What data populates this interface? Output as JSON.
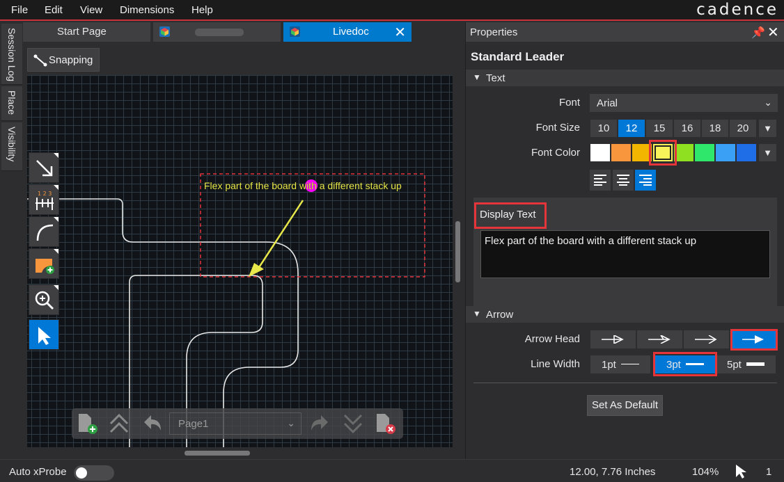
{
  "menu": [
    "File",
    "Edit",
    "View",
    "Dimensions",
    "Help"
  ],
  "brand": "cadence",
  "side_tabs": [
    "Session Log",
    "Place",
    "Visibility"
  ],
  "doc_tabs": {
    "start": "Start Page",
    "active": "Livedoc"
  },
  "toolbar": {
    "snapping": "Snapping"
  },
  "canvas": {
    "annotation_text": "Flex part of the board with a different stack up",
    "colors": {
      "annotation": "#e8e84a",
      "marker": "#ff00ff",
      "selection": "#e5353b",
      "trace": "#e8e8e8"
    }
  },
  "tools": [
    "arrow-line-icon",
    "dimension-icon",
    "arc-icon",
    "add-shape-icon",
    "zoom-icon",
    "select-pointer-icon"
  ],
  "pagebar": {
    "page": "Page1"
  },
  "properties": {
    "header": "Properties",
    "title": "Standard Leader",
    "text_section": "Text",
    "font_label": "Font",
    "font_value": "Arial",
    "font_size_label": "Font Size",
    "font_sizes": [
      "10",
      "12",
      "15",
      "16",
      "18",
      "20"
    ],
    "font_size_selected": "12",
    "font_color_label": "Font Color",
    "font_colors": [
      "#ffffff",
      "#f7963c",
      "#f3b600",
      "#f7f25a",
      "#8fe021",
      "#2fe76a",
      "#3aa0f5",
      "#1f6ee8"
    ],
    "font_color_selected": "#f7f25a",
    "display_text_label": "Display Text",
    "display_text_value": "Flex part of the board with a different stack up",
    "arrow_section": "Arrow",
    "arrow_head_label": "Arrow Head",
    "line_width_label": "Line Width",
    "line_widths": [
      "1pt",
      "3pt",
      "5pt"
    ],
    "line_width_selected": "3pt",
    "set_default": "Set As Default"
  },
  "status": {
    "auto_xprobe": "Auto xProbe",
    "auto_xprobe_on": false,
    "coords": "12.00, 7.76 Inches",
    "zoom": "104%",
    "count": "1"
  }
}
